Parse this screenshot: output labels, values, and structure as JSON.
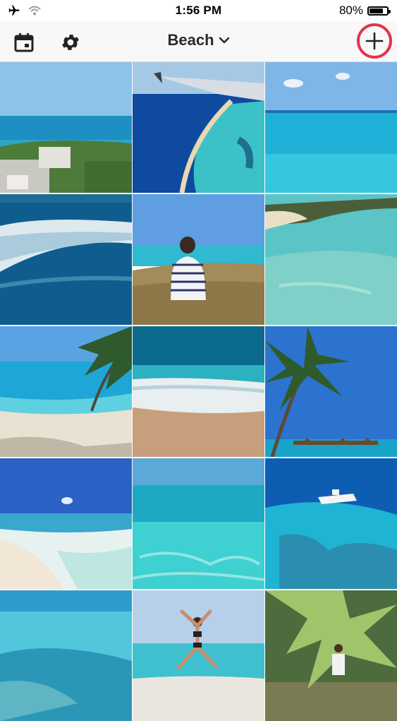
{
  "status_bar": {
    "time": "1:56 PM",
    "battery_percent": "80%",
    "battery_level": 0.8
  },
  "nav": {
    "title": "Beach",
    "calendar_icon": "calendar-icon",
    "settings_icon": "gear-icon",
    "add_icon": "plus-icon",
    "accent": "#e3344d"
  },
  "photos": [
    "beach-photo",
    "beach-photo",
    "beach-photo",
    "beach-photo",
    "beach-photo",
    "beach-photo",
    "beach-photo",
    "beach-photo",
    "beach-photo",
    "beach-photo",
    "beach-photo",
    "beach-photo",
    "beach-photo",
    "beach-photo",
    "beach-photo"
  ]
}
